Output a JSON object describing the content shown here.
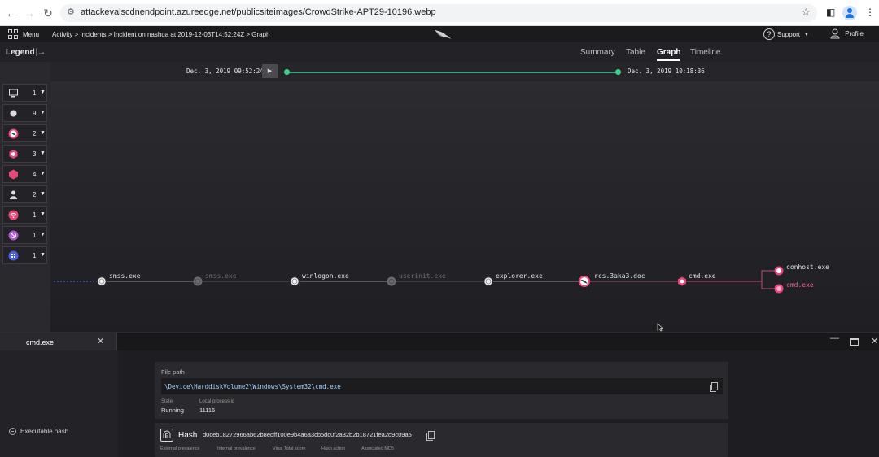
{
  "browser": {
    "url": "attackevalscdnendpoint.azureedge.net/publicsiteimages/CrowdStrike-APT29-10196.webp"
  },
  "header": {
    "menu_label": "Menu",
    "breadcrumb": "Activity > Incidents > Incident on nashua at 2019-12-03T14:52:24Z > Graph",
    "support_label": "Support",
    "profile_label": "Profile"
  },
  "tabsbar": {
    "legend_label": "Legend",
    "tabs": [
      {
        "label": "Summary",
        "active": false
      },
      {
        "label": "Table",
        "active": false
      },
      {
        "label": "Graph",
        "active": true
      },
      {
        "label": "Timeline",
        "active": false
      }
    ]
  },
  "timeline": {
    "start": "Dec. 3, 2019 09:52:24",
    "end": "Dec. 3, 2019 10:18:36"
  },
  "legend": {
    "items": [
      {
        "icon": "computer-icon",
        "count": "1"
      },
      {
        "icon": "circle-icon",
        "count": "9"
      },
      {
        "icon": "falcon-icon",
        "count": "2"
      },
      {
        "icon": "hexagon-small-icon",
        "count": "3"
      },
      {
        "icon": "hexagon-large-icon",
        "count": "4"
      },
      {
        "icon": "user-icon",
        "count": "2"
      },
      {
        "icon": "network-icon",
        "count": "1"
      },
      {
        "icon": "dns-icon",
        "count": "1"
      },
      {
        "icon": "module-icon",
        "count": "1"
      }
    ]
  },
  "graph": {
    "nodes": [
      {
        "label": "smss.exe",
        "style": "normal"
      },
      {
        "label": "smss.exe",
        "style": "dim"
      },
      {
        "label": "winlogon.exe",
        "style": "normal"
      },
      {
        "label": "userinit.exe",
        "style": "dim"
      },
      {
        "label": "explorer.exe",
        "style": "normal"
      },
      {
        "label": "rcs.3aka3.doc",
        "style": "falcon"
      },
      {
        "label": "cmd.exe",
        "style": "hexagon"
      },
      {
        "label": "conhost.exe",
        "style": "pink-white"
      },
      {
        "label": "cmd.exe",
        "style": "pink"
      }
    ]
  },
  "panel": {
    "tab_label": "cmd.exe",
    "executable_hash_label": "Executable hash",
    "file_path_label": "File path",
    "file_path": "\\Device\\HarddiskVolume2\\Windows\\System32\\cmd.exe",
    "state_label": "State",
    "state_value": "Running",
    "pid_label": "Local process id",
    "pid_value": "11116",
    "hash_title": "Hash",
    "hash_value": "d0ceb18272966ab62b8edff100e9b4a6a3cb5dc0f2a32b2b18721fea2d9c09a5",
    "hash_columns": [
      "External prevalence",
      "Internal prevalence",
      "Virus Total score",
      "Hash action",
      "Associated MD5"
    ]
  },
  "colors": {
    "accent_green": "#3ecf8e",
    "accent_pink": "#f0609e"
  }
}
